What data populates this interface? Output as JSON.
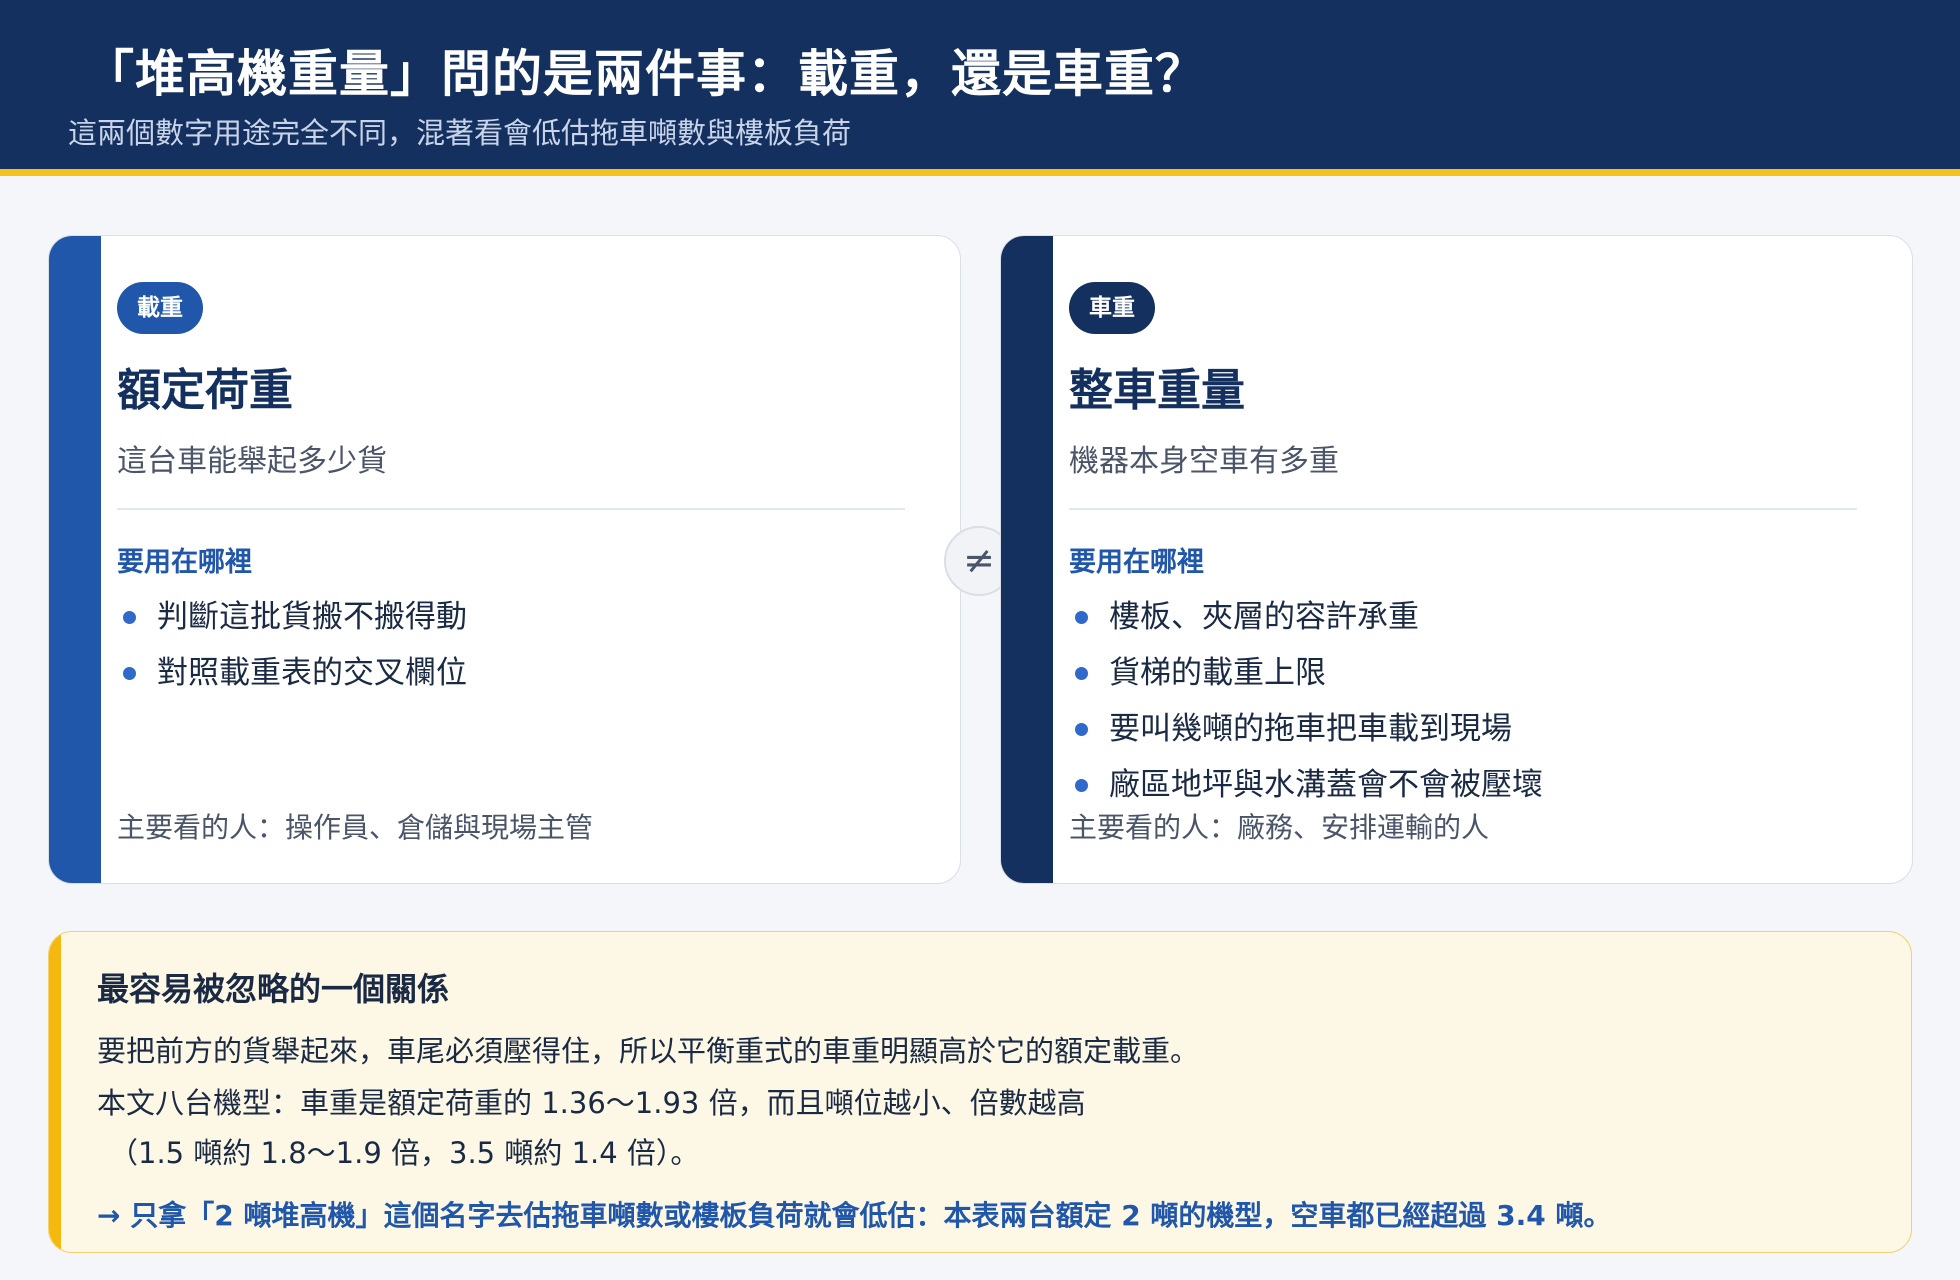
{
  "header": {
    "title": "「堆高機重量」問的是兩件事：載重，還是車重？",
    "subtitle": "這兩個數字用途完全不同，混著看會低估拖車噸數與樓板負荷"
  },
  "cards": [
    {
      "badge": "載重",
      "title": "額定荷重",
      "desc": "這台車能舉起多少貨",
      "usage_label": "要用在哪裡",
      "items": [
        "判斷這批貨搬不搬得動",
        "對照載重表的交叉欄位"
      ],
      "footer": "主要看的人：操作員、倉儲與現場主管"
    },
    {
      "badge": "車重",
      "title": "整車重量",
      "desc": "機器本身空車有多重",
      "usage_label": "要用在哪裡",
      "items": [
        "樓板、夾層的容許承重",
        "貨梯的載重上限",
        "要叫幾噸的拖車把車載到現場",
        "廠區地坪與水溝蓋會不會被壓壞"
      ],
      "footer": "主要看的人：廠務、安排運輸的人"
    }
  ],
  "separator": "≠",
  "note": {
    "title": "最容易被忽略的一個關係",
    "line1": "要把前方的貨舉起來，車尾必須壓得住，所以平衡重式的車重明顯高於它的額定載重。",
    "line2": "本文八台機型：車重是額定荷重的 1.36～1.93 倍，而且噸位越小、倍數越高",
    "line3": "（1.5 噸約 1.8～1.9 倍，3.5 噸約 1.4 倍）。",
    "highlight": "→ 只拿「2 噸堆高機」這個名字去估拖車噸數或樓板負荷就會低估：本表兩台額定 2 噸的機型，空車都已經超過 3.4 噸。"
  },
  "colors": {
    "header_bg": "#13305e",
    "accent_yellow": "#f5c21b",
    "load_blue": "#2157aa",
    "weight_navy": "#13305e",
    "note_bg": "#fdf8e6"
  }
}
